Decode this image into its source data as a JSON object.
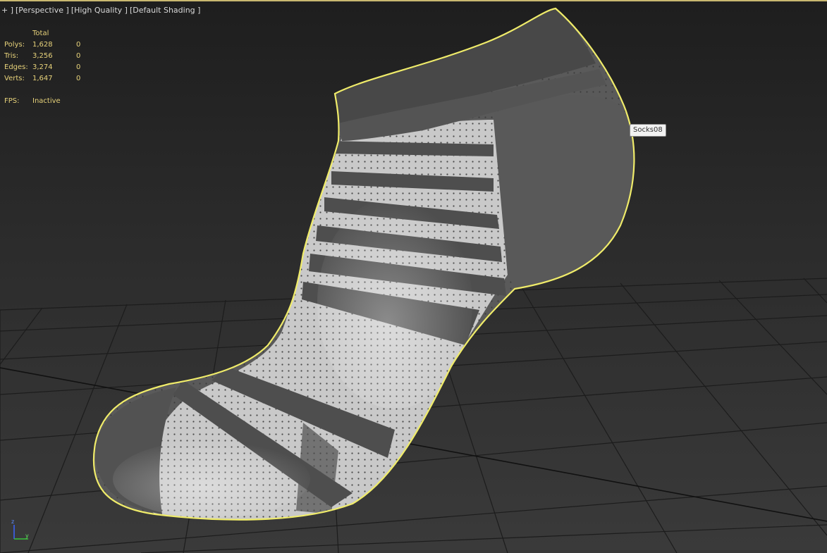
{
  "viewport": {
    "menu": "+ ]",
    "view": "[Perspective ]",
    "quality": "[High Quality ]",
    "shading": "[Default Shading ]"
  },
  "stats": {
    "header": "Total",
    "rows": [
      {
        "label": "Polys:",
        "total": "1,628",
        "selected": "0"
      },
      {
        "label": "Tris:",
        "total": "3,256",
        "selected": "0"
      },
      {
        "label": "Edges:",
        "total": "3,274",
        "selected": "0"
      },
      {
        "label": "Verts:",
        "total": "1,647",
        "selected": "0"
      }
    ],
    "fps_label": "FPS:",
    "fps_value": "Inactive"
  },
  "object_tooltip": "Socks08",
  "axis_gizmo": {
    "z": "z",
    "y": "y"
  },
  "colors": {
    "selection_outline": "#f0ec6a",
    "stats_text": "#e7d27a",
    "grid_line": "#1a1a1a",
    "accent": "#c9b870"
  }
}
